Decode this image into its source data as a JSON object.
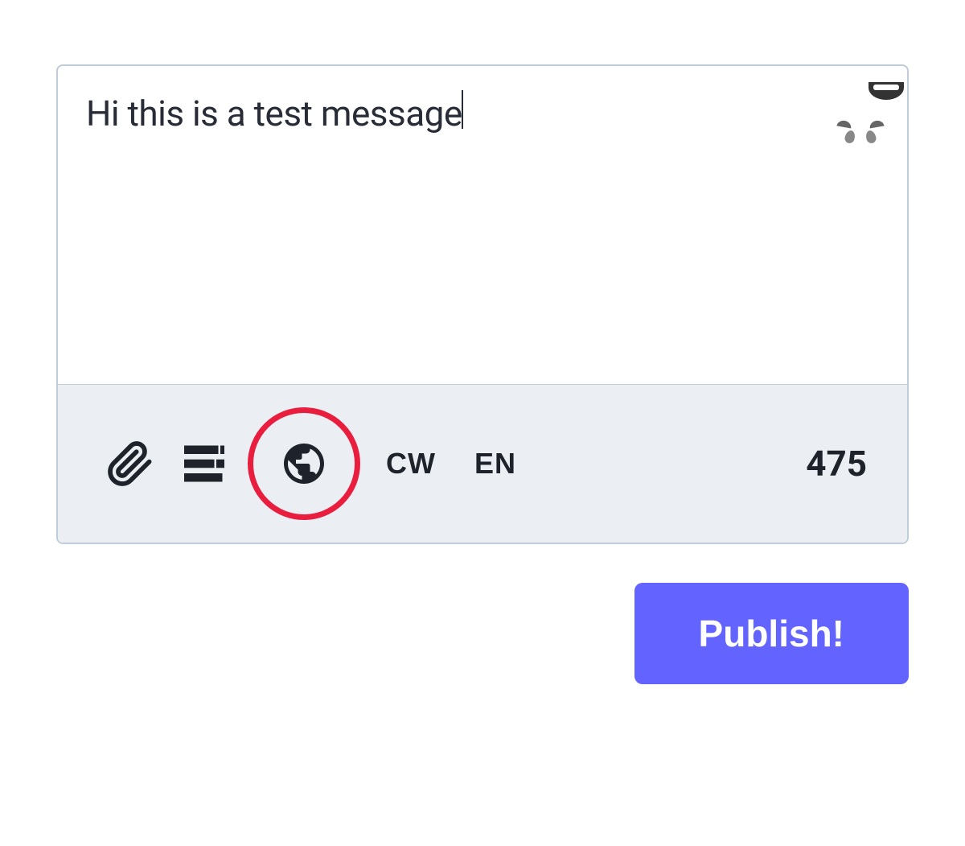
{
  "compose": {
    "text": "Hi this is a test message",
    "char_count": "475"
  },
  "toolbar": {
    "cw_label": "CW",
    "lang_label": "EN"
  },
  "actions": {
    "publish_label": "Publish!"
  }
}
